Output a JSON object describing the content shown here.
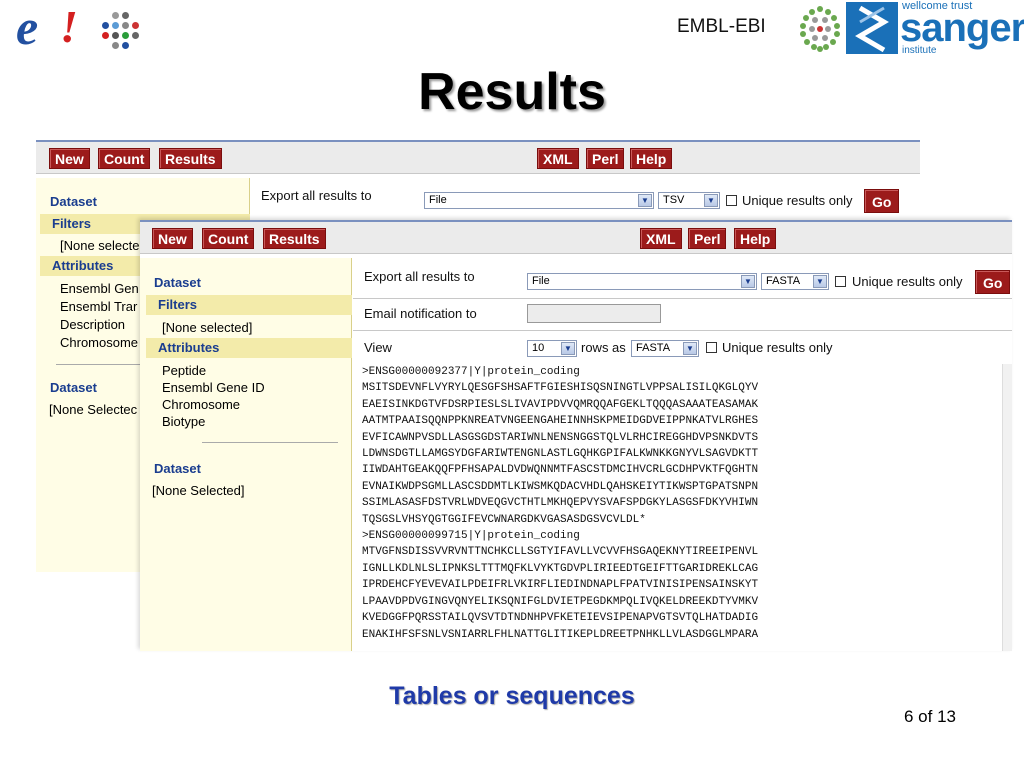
{
  "header": {
    "ebi_label": "EMBL-EBI",
    "sanger_top": "wellcome trust",
    "sanger_main": "sanger",
    "sanger_sub": "institute",
    "title": "Results"
  },
  "toolbar": {
    "new": "New",
    "count": "Count",
    "results": "Results",
    "xml": "XML",
    "perl": "Perl",
    "help": "Help"
  },
  "back_panel": {
    "dataset": "Dataset",
    "filters": "Filters",
    "filters_value": "[None selecte",
    "attributes": "Attributes",
    "attr_items": [
      "Ensembl Gen",
      "Ensembl Trar",
      "Description",
      "Chromosome"
    ],
    "dataset2": "Dataset",
    "dataset2_value": "[None Selectec",
    "export_label": "Export  all results to",
    "export_value": "File",
    "format_value": "TSV",
    "unique_label": "Unique results only",
    "go": "Go"
  },
  "front_panel": {
    "dataset": "Dataset",
    "filters": "Filters",
    "filters_value": "[None selected]",
    "attributes": "Attributes",
    "attr_items": [
      "Peptide",
      "Ensembl Gene ID",
      "Chromosome",
      "Biotype"
    ],
    "dataset2": "Dataset",
    "dataset2_value": "[None Selected]",
    "export_label": "Export  all results to",
    "export_value": "File",
    "format_value": "FASTA",
    "unique_label": "Unique results only",
    "go": "Go",
    "email_label": "Email notification to",
    "email_value": "",
    "view_label": "View",
    "view_count": "10",
    "rows_as": "rows as",
    "view_format": "FASTA",
    "view_unique": "Unique results only"
  },
  "sequences": [
    ">ENSG00000092377|Y|protein_coding",
    "MSITSDEVNFLVYRYLQESGFSHSAFTFGIESHISQSNINGTLVPPSALISILQKGLQYV",
    "EAEISINKDGTVFDSRPIESLSLIVAVIPDVVQMRQQAFGEKLTQQQASAAATEASAMAK",
    "AATMTPAAISQQNPPKNREATVNGEENGAHEINNHSKPMEIDGDVEIPPNKATVLRGHES",
    "EVFICAWNPVSDLLASGSGDSTARIWNLNENSNGGSTQLVLRHCIREGGHDVPSNKDVTS",
    "LDWNSDGTLLAMGSYDGFARIWTENGNLASTLGQHKGPIFALKWNKKGNYVLSAGVDKTT",
    "IIWDAHTGEAKQQFPFHSAPALDVDWQNNMTFASCSTDMCIHVCRLGCDHPVKTFQGHTN",
    "EVNAIKWDPSGMLLASCSDDMTLKIWSMKQDACVHDLQAHSKEIYTIKWSPTGPATSNPN",
    "SSIMLASASFDSTVRLWDVEQGVCTHTLMKHQEPVYSVAFSPDGKYLASGSFDKYVHIWN",
    "TQSGSLVHSYQGTGGIFEVCWNARGDKVGASASDGSVCVLDL*",
    ">ENSG00000099715|Y|protein_coding",
    "MTVGFNSDISSVVRVNTTNCHKCLLSGTYIFAVLLVCVVFHSGAQEKNYTIREEIPENVL",
    "IGNLLKDLNLSLIPNKSLTTTMQFKLVYKTGDVPLIRIEEDTGEIFTTGARIDREKLCAG",
    "IPRDEHCFYEVEVAILPDEIFRLVKIRFLIEDINDNAPLFPATVINISIPENSAINSKYT",
    "LPAAVDPDVGINGVQNYELIKSQNIFGLDVIETPEGDKMPQLIVQKELDREEKDTYVMKV",
    "KVEDGGFPQRSSTAILQVSVTDTNDNHPVFKETEIEVSIPENAPVGTSVTQLHATDADIG",
    "ENAKIHFSFSNLVSNIARRLFHLNATTGLITIKEPLDREETPNHKLLVLASDGGLMPARA"
  ],
  "caption": "Tables or sequences",
  "page_number": "6 of 13",
  "colors": {
    "button_red": "#9c1b1b",
    "panel_yellow": "#fffde6",
    "heading_blue": "#1a3d8f",
    "caption_blue": "#1f3aa8"
  }
}
